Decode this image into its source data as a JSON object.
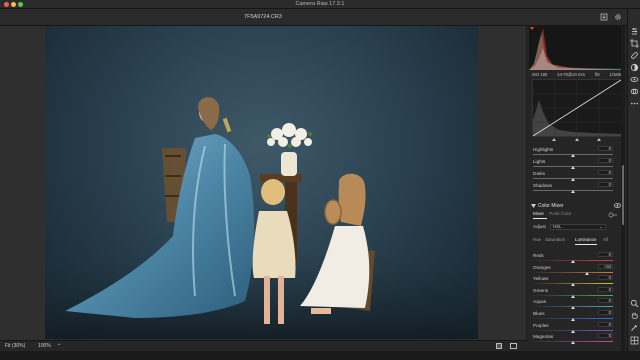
{
  "app": {
    "title": "Camera Raw 17.3.1"
  },
  "document": {
    "filename": "7F5A9724.CR3"
  },
  "camera_info": {
    "iso": "ISO 100",
    "lens": "24-70@24 mm",
    "aperture": "f/8",
    "shutter": "1/160s"
  },
  "tone_curve": {
    "rows": [
      {
        "label": "Highlights",
        "value": "0",
        "position": 0.5
      },
      {
        "label": "Lights",
        "value": "0",
        "position": 0.5
      },
      {
        "label": "Darks",
        "value": "0",
        "position": 0.5
      },
      {
        "label": "Shadows",
        "value": "0",
        "position": 0.5
      }
    ]
  },
  "color_mixer": {
    "title": "Color Mixer",
    "subtabs": [
      "Mixer",
      "Point Color"
    ],
    "adjust_label": "Adjust",
    "adjust_value": "HSL",
    "tabs": [
      "Hue",
      "Saturation",
      "Luminance",
      "All"
    ],
    "active_tab": "Luminance",
    "rows": [
      {
        "label": "Reds",
        "value": "0",
        "position": 0.5,
        "color": "#d04040"
      },
      {
        "label": "Oranges",
        "value": "+34",
        "position": 0.67,
        "color": "#d87a30"
      },
      {
        "label": "Yellows",
        "value": "0",
        "position": 0.5,
        "color": "#d6c43a"
      },
      {
        "label": "Greens",
        "value": "0",
        "position": 0.5,
        "color": "#4fae4a"
      },
      {
        "label": "Aquas",
        "value": "0",
        "position": 0.5,
        "color": "#3fb0b8"
      },
      {
        "label": "Blues",
        "value": "0",
        "position": 0.5,
        "color": "#3b6fd0"
      },
      {
        "label": "Purples",
        "value": "0",
        "position": 0.5,
        "color": "#8a52c8"
      },
      {
        "label": "Magentas",
        "value": "0",
        "position": 0.5,
        "color": "#c84aa8"
      }
    ]
  },
  "view": {
    "fit_label": "Fit (30%)",
    "zoom_label": "100%",
    "zoom_arrow": "⌄"
  },
  "icons": {
    "top": [
      "save-icon",
      "gear-icon"
    ],
    "tools": [
      "edit-icon",
      "crop-icon",
      "heal-icon",
      "mask-icon",
      "redeye-icon",
      "presets-icon",
      "more-icon",
      "zoom-icon",
      "hand-icon",
      "sampler-icon",
      "grid-icon"
    ]
  },
  "colors": {
    "accent": "#2d8ceb",
    "panel_bg": "#252525",
    "backdrop": "#2b4251"
  }
}
